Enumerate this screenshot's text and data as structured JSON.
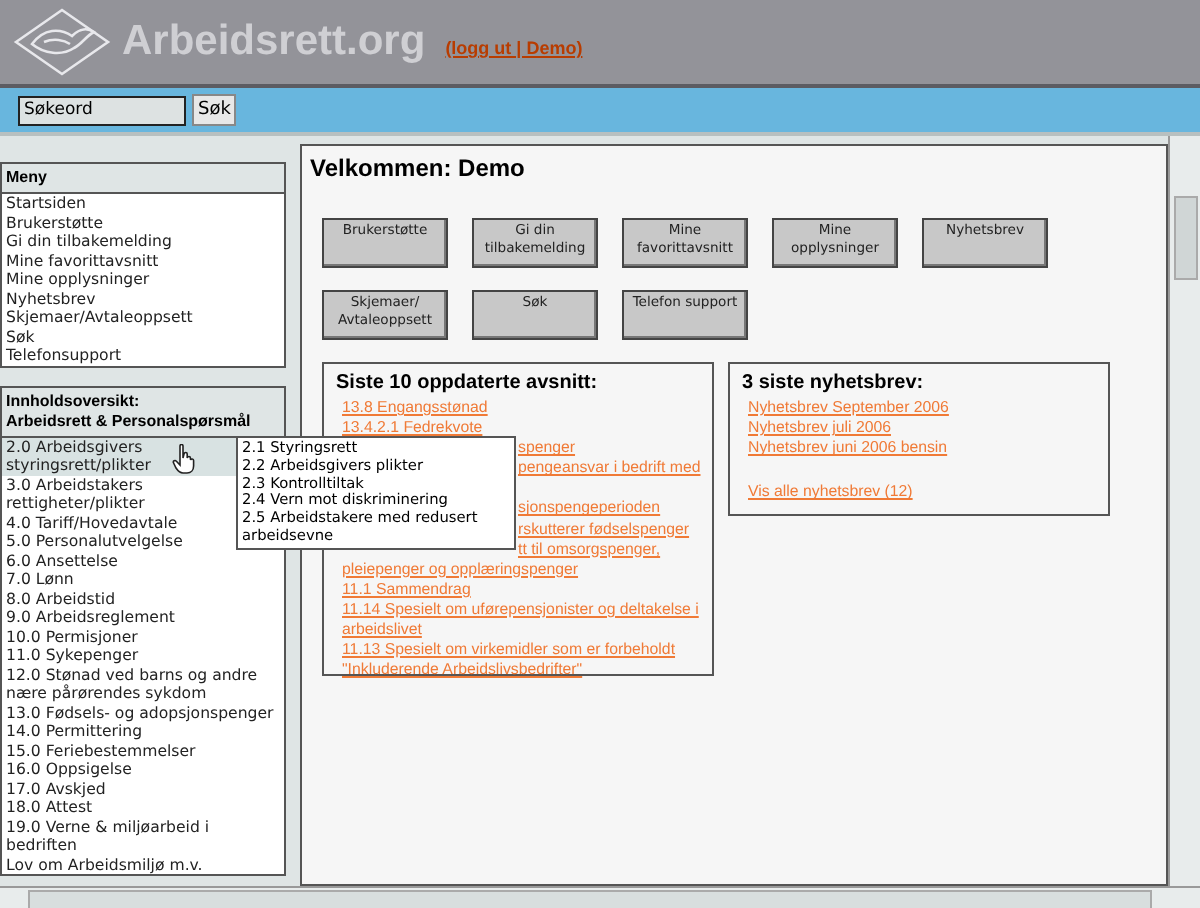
{
  "header": {
    "site_title": "Arbeidsrett.org",
    "logout_link": "(logg ut | Demo)"
  },
  "search": {
    "value": "Søkeord",
    "button": "Søk"
  },
  "menu": {
    "title": "Meny",
    "items": [
      "Startsiden",
      "Brukerstøtte",
      "Gi din tilbakemelding",
      "Mine favorittavsnitt",
      "Mine opplysninger",
      "Nyhetsbrev",
      "Skjemaer/Avtaleoppsett",
      "Søk",
      "Telefonsupport"
    ]
  },
  "contents": {
    "title": "Innholdsoversikt:\nArbeidsrett & Personalspørsmål",
    "items": [
      {
        "label": "2.0 Arbeidsgivers styringsrett/plikter",
        "selected": true
      },
      {
        "label": "3.0 Arbeidstakers rettigheter/plikter",
        "selected": false
      },
      {
        "label": "4.0 Tariff/Hovedavtale",
        "selected": false
      },
      {
        "label": "5.0 Personalutvelgelse",
        "selected": false
      },
      {
        "label": "6.0 Ansettelse",
        "selected": false
      },
      {
        "label": "7.0 Lønn",
        "selected": false
      },
      {
        "label": "8.0 Arbeidstid",
        "selected": false
      },
      {
        "label": "9.0 Arbeidsreglement",
        "selected": false
      },
      {
        "label": "10.0 Permisjoner",
        "selected": false
      },
      {
        "label": "11.0 Sykepenger",
        "selected": false
      },
      {
        "label": "12.0 Stønad ved barns og andre nære pårørendes sykdom",
        "selected": false
      },
      {
        "label": "13.0 Fødsels- og adopsjonspenger",
        "selected": false
      },
      {
        "label": "14.0 Permittering",
        "selected": false
      },
      {
        "label": "15.0 Feriebestemmelser",
        "selected": false
      },
      {
        "label": "16.0 Oppsigelse",
        "selected": false
      },
      {
        "label": "17.0 Avskjed",
        "selected": false
      },
      {
        "label": "18.0 Attest",
        "selected": false
      },
      {
        "label": "19.0 Verne & miljøarbeid i bedriften",
        "selected": false
      },
      {
        "label": "Lov om Arbeidsmiljø m.v.",
        "selected": false
      }
    ]
  },
  "submenu": [
    "2.1 Styringsrett",
    "2.2 Arbeidsgivers plikter",
    "2.3 Kontrolltiltak",
    "2.4 Vern mot diskriminering",
    "2.5 Arbeidstakere med redusert arbeidsevne"
  ],
  "main": {
    "title": "Velkommen: Demo",
    "buttons": [
      "Brukerstøtte",
      "Gi din tilbakemelding",
      "Mine favorittavsnitt",
      "Mine opplysninger",
      "Nyhetsbrev",
      "Skjemaer/ Avtaleoppsett",
      "Søk",
      "Telefon support"
    ],
    "recent": {
      "title": "Siste 10 oppdaterte avsnitt:",
      "links": [
        {
          "kind": "full",
          "text": "13.8 Engangsstønad"
        },
        {
          "kind": "full",
          "text": "13.4.2.1 Fedrekvote"
        },
        {
          "kind": "partial",
          "text": "spenger"
        },
        {
          "kind": "partial",
          "text": "pengeansvar i bedrift med"
        },
        {
          "kind": "covered"
        },
        {
          "kind": "partial",
          "text": "sjonspengeperioden"
        },
        {
          "kind": "partial",
          "text": "rskutterer fødselspenger"
        },
        {
          "kind": "partial",
          "text": "tt til omsorgspenger,"
        },
        {
          "kind": "full",
          "text": "pleiepenger og opplæringspenger"
        },
        {
          "kind": "full",
          "text": "11.1 Sammendrag"
        },
        {
          "kind": "full",
          "text": "11.14 Spesielt om uførepensjonister og deltakelse i arbeidslivet"
        },
        {
          "kind": "full",
          "text": "11.13 Spesielt om virkemidler som er forbeholdt \"Inkluderende Arbeidslivsbedrifter\""
        }
      ]
    },
    "newsletters": {
      "title": "3 siste nyhetsbrev:",
      "links": [
        "Nyhetsbrev September 2006",
        "Nyhetsbrev juli 2006",
        "Nyhetsbrev juni 2006 bensin"
      ],
      "all_link": "Vis alle nyhetsbrev (12)"
    }
  }
}
